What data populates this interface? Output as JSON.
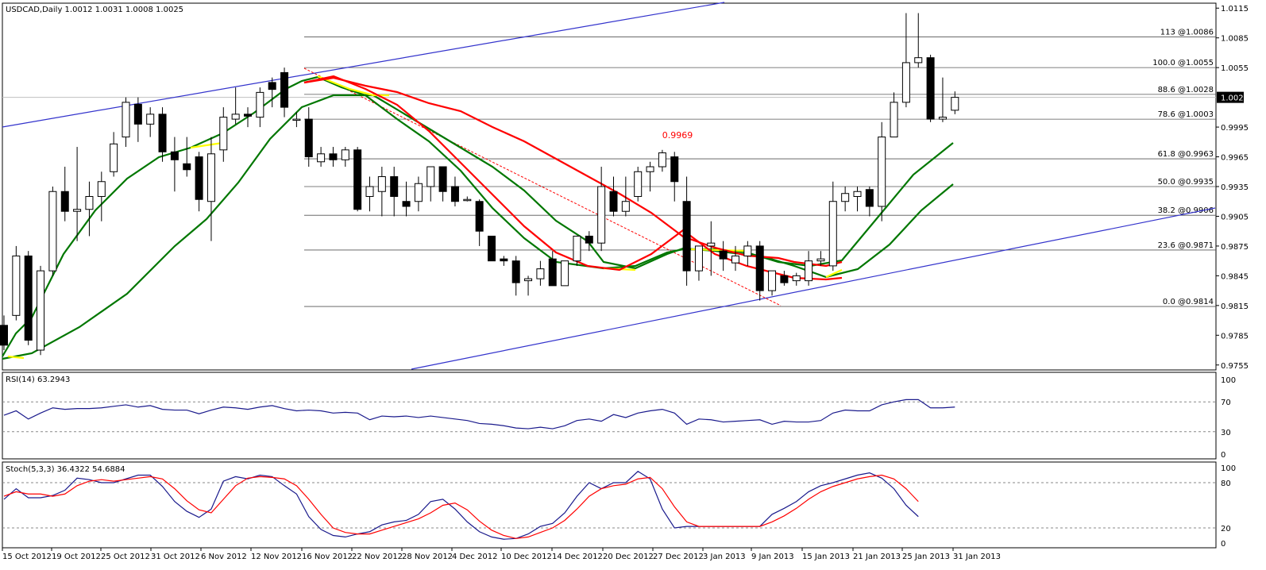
{
  "header": {
    "main": "USDCAD,Daily  1.0012 1.0031 1.0008 1.0025",
    "rsi": "RSI(14) 63.2943",
    "stoch": "Stoch(5,3,3) 36.4322 54.6884"
  },
  "chart_data": {
    "type": "candlestick",
    "symbol": "USDCAD",
    "timeframe": "Daily",
    "price_axis": {
      "ticks": [
        "1.0115",
        "1.0085",
        "1.0055",
        "0.9995",
        "0.9965",
        "0.9935",
        "0.9905",
        "0.9875",
        "0.9845",
        "0.9815",
        "0.9785",
        "0.9755"
      ],
      "range": [
        0.975,
        1.012
      ],
      "current": "1.0025"
    },
    "date_labels": [
      "15 Oct 2012",
      "19 Oct 2012",
      "25 Oct 2012",
      "31 Oct 2012",
      "6 Nov 2012",
      "12 Nov 2012",
      "16 Nov 2012",
      "22 Nov 2012",
      "28 Nov 2012",
      "4 Dec 2012",
      "10 Dec 2012",
      "14 Dec 2012",
      "20 Dec 2012",
      "27 Dec 2012",
      "3 Jan 2013",
      "9 Jan 2013",
      "15 Jan 2013",
      "21 Jan 2013",
      "25 Jan 2013",
      "31 Jan 2013"
    ],
    "candles": [
      [
        0.9795,
        0.9805,
        0.977,
        0.9775
      ],
      [
        0.9805,
        0.9875,
        0.98,
        0.9865
      ],
      [
        0.9865,
        0.987,
        0.9775,
        0.978
      ],
      [
        0.977,
        0.9855,
        0.9765,
        0.985
      ],
      [
        0.985,
        0.9935,
        0.9845,
        0.993
      ],
      [
        0.993,
        0.9955,
        0.99,
        0.991
      ],
      [
        0.991,
        0.9975,
        0.988,
        0.9912
      ],
      [
        0.9912,
        0.994,
        0.9885,
        0.9925
      ],
      [
        0.9925,
        0.995,
        0.99,
        0.994
      ],
      [
        0.995,
        0.999,
        0.9945,
        0.9978
      ],
      [
        0.9985,
        1.0025,
        0.9975,
        1.002
      ],
      [
        1.0018,
        1.0025,
        0.998,
        0.9998
      ],
      [
        0.9998,
        1.0015,
        0.9985,
        1.0008
      ],
      [
        1.0008,
        1.0015,
        0.996,
        0.997
      ],
      [
        0.997,
        0.9985,
        0.993,
        0.9962
      ],
      [
        0.9958,
        0.9985,
        0.9945,
        0.9952
      ],
      [
        0.9965,
        0.997,
        0.991,
        0.9922
      ],
      [
        0.992,
        0.9985,
        0.988,
        0.9968
      ],
      [
        0.9972,
        1.0015,
        0.996,
        1.0005
      ],
      [
        1.0003,
        1.0035,
        0.9998,
        1.0008
      ],
      [
        1.0008,
        1.0015,
        0.9995,
        1.0006
      ],
      [
        1.0005,
        1.0035,
        0.9995,
        1.003
      ],
      [
        1.004,
        1.0045,
        1.0015,
        1.0033
      ],
      [
        1.005,
        1.0055,
        1.0005,
        1.0015
      ],
      [
        1.0002,
        1.001,
        0.9995,
        1.0003
      ],
      [
        1.0003,
        1.0015,
        0.9955,
        0.9965
      ],
      [
        0.996,
        0.9975,
        0.9955,
        0.9968
      ],
      [
        0.9968,
        0.9975,
        0.9955,
        0.9962
      ],
      [
        0.9962,
        0.9975,
        0.9955,
        0.9972
      ],
      [
        0.9972,
        0.9975,
        0.991,
        0.9912
      ],
      [
        0.9925,
        0.9945,
        0.991,
        0.9935
      ],
      [
        0.993,
        0.9955,
        0.9905,
        0.9945
      ],
      [
        0.9945,
        0.9955,
        0.9905,
        0.9925
      ],
      [
        0.992,
        0.994,
        0.9905,
        0.9915
      ],
      [
        0.992,
        0.9945,
        0.991,
        0.9938
      ],
      [
        0.9935,
        0.9955,
        0.992,
        0.9955
      ],
      [
        0.9955,
        0.9955,
        0.992,
        0.993
      ],
      [
        0.9935,
        0.9945,
        0.9915,
        0.992
      ],
      [
        0.9922,
        0.9925,
        0.992,
        0.9922
      ],
      [
        0.992,
        0.9922,
        0.9875,
        0.989
      ],
      [
        0.9885,
        0.988,
        0.986,
        0.986
      ],
      [
        0.9862,
        0.9865,
        0.9855,
        0.986
      ],
      [
        0.986,
        0.9865,
        0.9825,
        0.9838
      ],
      [
        0.984,
        0.9845,
        0.9825,
        0.9842
      ],
      [
        0.9842,
        0.986,
        0.9835,
        0.9852
      ],
      [
        0.9862,
        0.987,
        0.9835,
        0.9835
      ],
      [
        0.9835,
        0.986,
        0.9835,
        0.986
      ],
      [
        0.986,
        0.9885,
        0.9855,
        0.9885
      ],
      [
        0.9885,
        0.989,
        0.987,
        0.9878
      ],
      [
        0.9878,
        0.9955,
        0.987,
        0.9935
      ],
      [
        0.993,
        0.9945,
        0.9905,
        0.991
      ],
      [
        0.991,
        0.9945,
        0.9905,
        0.992
      ],
      [
        0.9925,
        0.9955,
        0.992,
        0.995
      ],
      [
        0.995,
        0.996,
        0.993,
        0.9955
      ],
      [
        0.9955,
        0.9972,
        0.995,
        0.9969
      ],
      [
        0.9965,
        0.997,
        0.992,
        0.994
      ],
      [
        0.992,
        0.9945,
        0.9835,
        0.985
      ],
      [
        0.985,
        0.9875,
        0.984,
        0.9875
      ],
      [
        0.9875,
        0.99,
        0.9845,
        0.9878
      ],
      [
        0.987,
        0.988,
        0.985,
        0.9862
      ],
      [
        0.9858,
        0.9875,
        0.985,
        0.9865
      ],
      [
        0.9865,
        0.988,
        0.9855,
        0.9875
      ],
      [
        0.9875,
        0.988,
        0.982,
        0.983
      ],
      [
        0.983,
        0.985,
        0.9825,
        0.985
      ],
      [
        0.9845,
        0.985,
        0.9835,
        0.9838
      ],
      [
        0.984,
        0.9848,
        0.9835,
        0.9845
      ],
      [
        0.984,
        0.987,
        0.9835,
        0.986
      ],
      [
        0.986,
        0.987,
        0.9855,
        0.9862
      ],
      [
        0.9855,
        0.994,
        0.985,
        0.992
      ],
      [
        0.992,
        0.9935,
        0.991,
        0.9928
      ],
      [
        0.9925,
        0.9935,
        0.991,
        0.993
      ],
      [
        0.9932,
        0.9935,
        0.9905,
        0.9915
      ],
      [
        0.9915,
        1.0,
        0.99,
        0.9985
      ],
      [
        0.9985,
        1.003,
        0.9985,
        1.002
      ],
      [
        1.002,
        1.011,
        1.0015,
        1.006
      ],
      [
        1.006,
        1.011,
        1.0055,
        1.0065
      ],
      [
        1.0065,
        1.0068,
        1.0,
        1.0003
      ],
      [
        1.0003,
        1.0045,
        1.0,
        1.0005
      ],
      [
        1.0012,
        1.0031,
        1.0008,
        1.0025
      ]
    ],
    "fib_levels": [
      {
        "label": "113 @1.0086",
        "price": 1.0086
      },
      {
        "label": "100.0 @1.0055",
        "price": 1.0055
      },
      {
        "label": "88.6 @1.0028",
        "price": 1.0028
      },
      {
        "label": "78.6 @1.0003",
        "price": 1.0003
      },
      {
        "label": "61.8 @0.9963",
        "price": 0.9963
      },
      {
        "label": "50.0 @0.9935",
        "price": 0.9935
      },
      {
        "label": "38.2 @0.9906",
        "price": 0.9906
      },
      {
        "label": "23.6 @0.9871",
        "price": 0.9871
      },
      {
        "label": "0.0 @0.9814",
        "price": 0.9814
      }
    ],
    "annotation": {
      "text": "0.9969",
      "color": "#ff0000"
    },
    "rsi": {
      "ticks": [
        "100",
        "70",
        "30",
        "0"
      ],
      "values": [
        52,
        58,
        47,
        55,
        62,
        60,
        61,
        61,
        62,
        64,
        66,
        63,
        65,
        60,
        59,
        59,
        54,
        59,
        63,
        62,
        60,
        63,
        65,
        61,
        58,
        59,
        58,
        55,
        56,
        55,
        46,
        51,
        50,
        51,
        49,
        51,
        49,
        47,
        45,
        41,
        40,
        38,
        35,
        34,
        36,
        34,
        38,
        45,
        47,
        44,
        53,
        49,
        55,
        58,
        60,
        55,
        40,
        47,
        46,
        43,
        44,
        45,
        46,
        40,
        44,
        43,
        43,
        45,
        55,
        59,
        58,
        58,
        66,
        70,
        73,
        73,
        62,
        62,
        63
      ]
    },
    "stoch": {
      "ticks": [
        "100",
        "80",
        "20",
        "0"
      ],
      "k": [
        58,
        72,
        60,
        60,
        63,
        70,
        86,
        84,
        80,
        80,
        85,
        90,
        90,
        75,
        55,
        42,
        34,
        45,
        82,
        88,
        85,
        90,
        88,
        76,
        65,
        35,
        18,
        10,
        8,
        12,
        15,
        24,
        28,
        30,
        38,
        55,
        58,
        45,
        28,
        15,
        8,
        5,
        6,
        12,
        22,
        26,
        40,
        62,
        80,
        72,
        80,
        80,
        95,
        85,
        45,
        20,
        22,
        22,
        22,
        22,
        22,
        22,
        22,
        38,
        46,
        55,
        68,
        76,
        80,
        85,
        90,
        93,
        86,
        72,
        50,
        35
      ],
      "d": [
        62,
        68,
        65,
        65,
        62,
        65,
        76,
        82,
        84,
        82,
        84,
        86,
        88,
        85,
        72,
        56,
        44,
        40,
        58,
        76,
        86,
        88,
        87,
        85,
        76,
        58,
        38,
        20,
        14,
        12,
        12,
        17,
        22,
        27,
        32,
        40,
        50,
        53,
        44,
        29,
        17,
        10,
        6,
        8,
        14,
        20,
        30,
        45,
        62,
        72,
        76,
        78,
        85,
        87,
        72,
        48,
        28,
        22,
        22,
        22,
        22,
        22,
        22,
        28,
        36,
        46,
        58,
        68,
        75,
        80,
        85,
        88,
        90,
        85,
        72,
        55
      ]
    }
  }
}
